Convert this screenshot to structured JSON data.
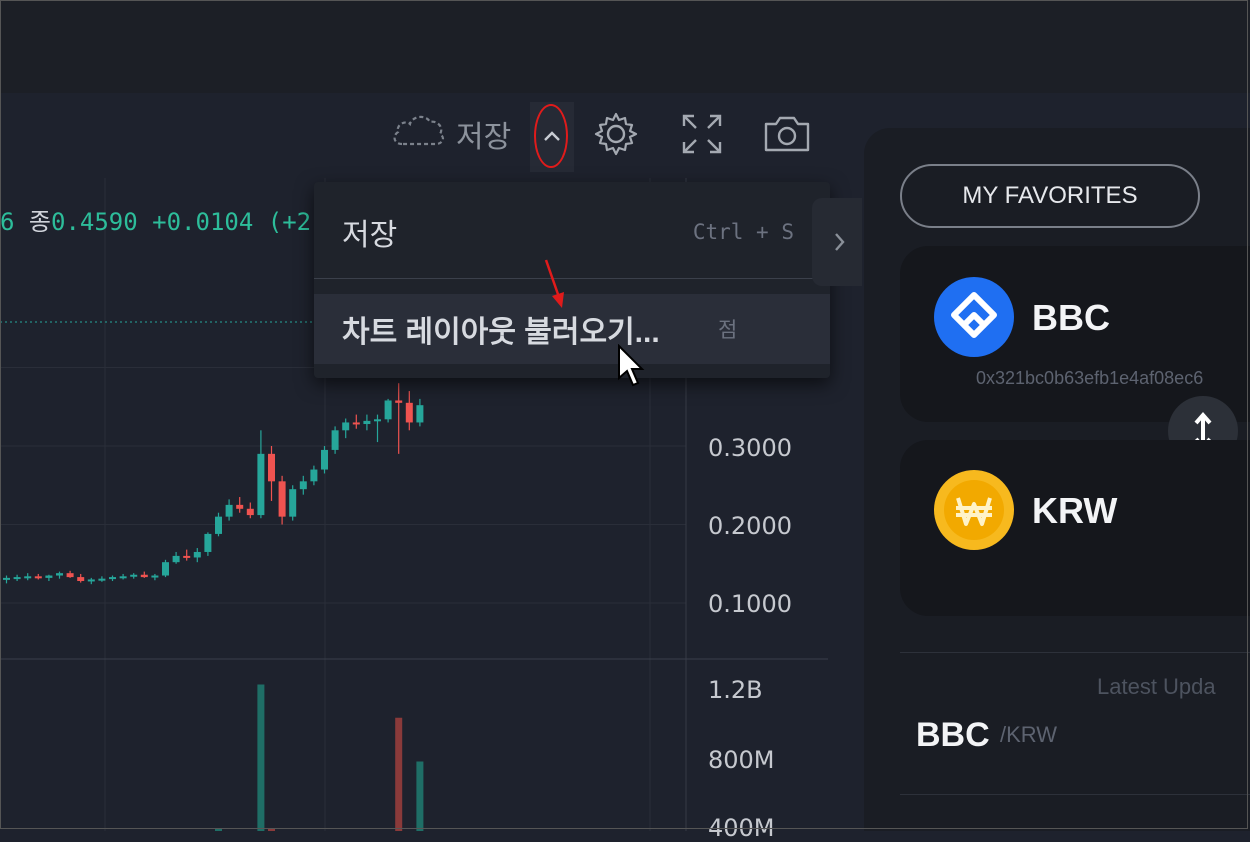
{
  "toolbar": {
    "save_label": "저장",
    "icons": [
      "cloud-icon",
      "chevron-up-icon",
      "gear-icon",
      "fullscreen-icon",
      "camera-icon"
    ]
  },
  "ohlc": {
    "prefix": "6",
    "close_label": "종",
    "close_value": "0.4590",
    "change": "+0.0104 (+2."
  },
  "menu": {
    "items": [
      {
        "label": "저장",
        "shortcut": "Ctrl + S"
      },
      {
        "label": "차트 레이아웃 불러오기...",
        "shortcut": "점"
      }
    ]
  },
  "price_axis": [
    "0.3000",
    "0.2000",
    "0.1000"
  ],
  "volume_axis": [
    "1.2B",
    "800M",
    "400M"
  ],
  "right_panel": {
    "favorites_label": "MY FAVORITES",
    "tokens": [
      {
        "symbol": "BBC",
        "address": "0x321bc0b63efb1e4af08ec6",
        "icon": "bbc-logo-icon"
      },
      {
        "symbol": "KRW",
        "icon": "won-coin-icon"
      }
    ],
    "latest_label": "Latest Upda",
    "pair_base": "BBC",
    "pair_quote": "/KRW"
  },
  "colors": {
    "up": "#26a69a",
    "down": "#ef5350",
    "annotation": "#e01b1b",
    "bbc_blue": "#1f6ff2",
    "krw_gold": "#f7b91e"
  },
  "chart_data": {
    "type": "candlestick",
    "y_range": [
      0.0,
      0.46
    ],
    "candles": [
      {
        "o": 0.13,
        "h": 0.135,
        "l": 0.125,
        "c": 0.132
      },
      {
        "o": 0.132,
        "h": 0.136,
        "l": 0.128,
        "c": 0.133
      },
      {
        "o": 0.133,
        "h": 0.138,
        "l": 0.129,
        "c": 0.134
      },
      {
        "o": 0.134,
        "h": 0.137,
        "l": 0.13,
        "c": 0.132
      },
      {
        "o": 0.132,
        "h": 0.136,
        "l": 0.128,
        "c": 0.135
      },
      {
        "o": 0.135,
        "h": 0.14,
        "l": 0.131,
        "c": 0.138
      },
      {
        "o": 0.138,
        "h": 0.141,
        "l": 0.132,
        "c": 0.133
      },
      {
        "o": 0.133,
        "h": 0.137,
        "l": 0.126,
        "c": 0.128
      },
      {
        "o": 0.128,
        "h": 0.132,
        "l": 0.124,
        "c": 0.13
      },
      {
        "o": 0.13,
        "h": 0.134,
        "l": 0.127,
        "c": 0.131
      },
      {
        "o": 0.131,
        "h": 0.135,
        "l": 0.128,
        "c": 0.133
      },
      {
        "o": 0.133,
        "h": 0.137,
        "l": 0.13,
        "c": 0.134
      },
      {
        "o": 0.134,
        "h": 0.138,
        "l": 0.131,
        "c": 0.136
      },
      {
        "o": 0.136,
        "h": 0.14,
        "l": 0.132,
        "c": 0.133
      },
      {
        "o": 0.133,
        "h": 0.137,
        "l": 0.129,
        "c": 0.135
      },
      {
        "o": 0.135,
        "h": 0.155,
        "l": 0.133,
        "c": 0.152
      },
      {
        "o": 0.152,
        "h": 0.165,
        "l": 0.15,
        "c": 0.16
      },
      {
        "o": 0.16,
        "h": 0.168,
        "l": 0.154,
        "c": 0.158
      },
      {
        "o": 0.158,
        "h": 0.17,
        "l": 0.152,
        "c": 0.165
      },
      {
        "o": 0.165,
        "h": 0.19,
        "l": 0.16,
        "c": 0.188
      },
      {
        "o": 0.188,
        "h": 0.215,
        "l": 0.185,
        "c": 0.21
      },
      {
        "o": 0.21,
        "h": 0.232,
        "l": 0.205,
        "c": 0.225
      },
      {
        "o": 0.225,
        "h": 0.235,
        "l": 0.215,
        "c": 0.22
      },
      {
        "o": 0.22,
        "h": 0.228,
        "l": 0.208,
        "c": 0.212
      },
      {
        "o": 0.212,
        "h": 0.32,
        "l": 0.208,
        "c": 0.29
      },
      {
        "o": 0.29,
        "h": 0.3,
        "l": 0.23,
        "c": 0.255
      },
      {
        "o": 0.255,
        "h": 0.262,
        "l": 0.2,
        "c": 0.21
      },
      {
        "o": 0.21,
        "h": 0.25,
        "l": 0.205,
        "c": 0.245
      },
      {
        "o": 0.245,
        "h": 0.262,
        "l": 0.238,
        "c": 0.255
      },
      {
        "o": 0.255,
        "h": 0.275,
        "l": 0.25,
        "c": 0.27
      },
      {
        "o": 0.27,
        "h": 0.3,
        "l": 0.265,
        "c": 0.295
      },
      {
        "o": 0.295,
        "h": 0.325,
        "l": 0.29,
        "c": 0.32
      },
      {
        "o": 0.32,
        "h": 0.335,
        "l": 0.31,
        "c": 0.33
      },
      {
        "o": 0.33,
        "h": 0.34,
        "l": 0.322,
        "c": 0.328
      },
      {
        "o": 0.328,
        "h": 0.34,
        "l": 0.32,
        "c": 0.332
      },
      {
        "o": 0.332,
        "h": 0.34,
        "l": 0.305,
        "c": 0.334
      },
      {
        "o": 0.334,
        "h": 0.36,
        "l": 0.33,
        "c": 0.358
      },
      {
        "o": 0.358,
        "h": 0.38,
        "l": 0.29,
        "c": 0.355
      },
      {
        "o": 0.355,
        "h": 0.37,
        "l": 0.32,
        "c": 0.33
      },
      {
        "o": 0.33,
        "h": 0.36,
        "l": 0.325,
        "c": 0.352
      }
    ],
    "volume_range": [
      0,
      1.4
    ],
    "volume_unit": "B",
    "volumes": [
      {
        "v": 0.02,
        "up": true
      },
      {
        "v": 0.02,
        "up": false
      },
      {
        "v": 0.03,
        "up": true
      },
      {
        "v": 0.02,
        "up": true
      },
      {
        "v": 0.03,
        "up": false
      },
      {
        "v": 0.02,
        "up": true
      },
      {
        "v": 0.04,
        "up": true
      },
      {
        "v": 0.03,
        "up": true
      },
      {
        "v": 0.05,
        "up": true
      },
      {
        "v": 0.02,
        "up": false
      },
      {
        "v": 0.03,
        "up": true
      },
      {
        "v": 0.04,
        "up": true
      },
      {
        "v": 0.06,
        "up": true
      },
      {
        "v": 0.2,
        "up": true
      },
      {
        "v": 0.06,
        "up": true
      },
      {
        "v": 0.05,
        "up": false
      },
      {
        "v": 0.1,
        "up": true
      },
      {
        "v": 0.08,
        "up": true
      },
      {
        "v": 0.12,
        "up": true
      },
      {
        "v": 0.35,
        "up": true
      },
      {
        "v": 0.4,
        "up": true
      },
      {
        "v": 0.18,
        "up": true
      },
      {
        "v": 0.12,
        "up": false
      },
      {
        "v": 0.1,
        "up": true
      },
      {
        "v": 1.22,
        "up": true
      },
      {
        "v": 0.4,
        "up": false
      },
      {
        "v": 0.35,
        "up": false
      },
      {
        "v": 0.25,
        "up": true
      },
      {
        "v": 0.18,
        "up": true
      },
      {
        "v": 0.2,
        "up": true
      },
      {
        "v": 0.3,
        "up": true
      },
      {
        "v": 0.22,
        "up": true
      },
      {
        "v": 0.15,
        "up": true
      },
      {
        "v": 0.18,
        "up": false
      },
      {
        "v": 0.12,
        "up": true
      },
      {
        "v": 0.1,
        "up": true
      },
      {
        "v": 0.2,
        "up": true
      },
      {
        "v": 1.03,
        "up": false
      },
      {
        "v": 0.25,
        "up": false
      },
      {
        "v": 0.78,
        "up": true
      }
    ]
  }
}
